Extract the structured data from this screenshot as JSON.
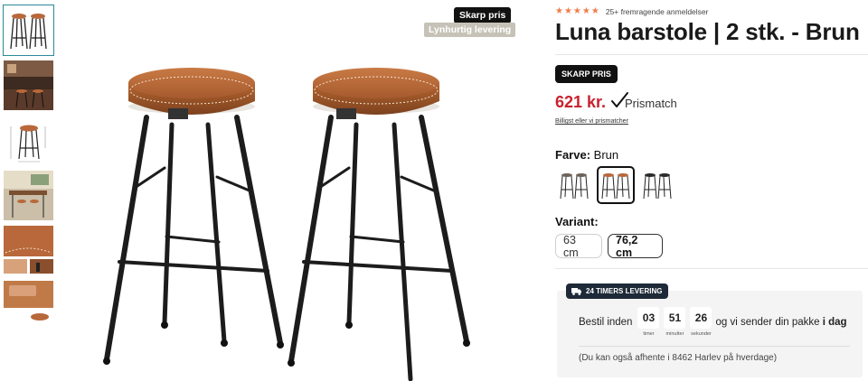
{
  "gallery": {
    "badge_primary": "Skarp pris",
    "badge_secondary": "Lynhurtig levering",
    "thumbnails": [
      {
        "name": "thumb-product-front"
      },
      {
        "name": "thumb-room-scene"
      },
      {
        "name": "thumb-dimensions"
      },
      {
        "name": "thumb-dining-scene"
      },
      {
        "name": "thumb-seat-detail"
      },
      {
        "name": "thumb-material-detail"
      }
    ]
  },
  "product": {
    "stars": "★★★★★",
    "reviews_text": "25+ fremragende anmeldelser",
    "title": "Luna barstole | 2 stk. - Brun",
    "price_badge": "SKARP PRIS",
    "price": "621 kr.",
    "price_match": "Prismatch",
    "price_note": "Billigst eller vi prismatcher",
    "color_label": "Farve:",
    "color_value": "Brun",
    "colors": [
      {
        "name": "Grå",
        "seat": "#6b6258",
        "selected": false
      },
      {
        "name": "Brun",
        "seat": "#b8683a",
        "selected": true
      },
      {
        "name": "Sort",
        "seat": "#2a2a2a",
        "selected": false
      }
    ],
    "variant_label": "Variant:",
    "variants": [
      {
        "label": "63 cm",
        "selected": false
      },
      {
        "label": "76,2 cm",
        "selected": true
      }
    ]
  },
  "delivery": {
    "tag": "24 TIMERS LEVERING",
    "order_prefix": "Bestil inden",
    "countdown": {
      "hours": "03",
      "hours_label": "timer",
      "minutes": "51",
      "minutes_label": "minutter",
      "seconds": "26",
      "seconds_label": "sekunder"
    },
    "order_suffix": "og vi sender din pakke",
    "order_suffix_bold": "i dag",
    "pickup": "(Du kan også afhente i 8462 Harlev på hverdage)"
  },
  "colors": {
    "price_red": "#c8222d",
    "star_orange": "#f07d48",
    "seat_brown": "#b8683a",
    "delivery_tag_bg": "#1e2a38"
  }
}
